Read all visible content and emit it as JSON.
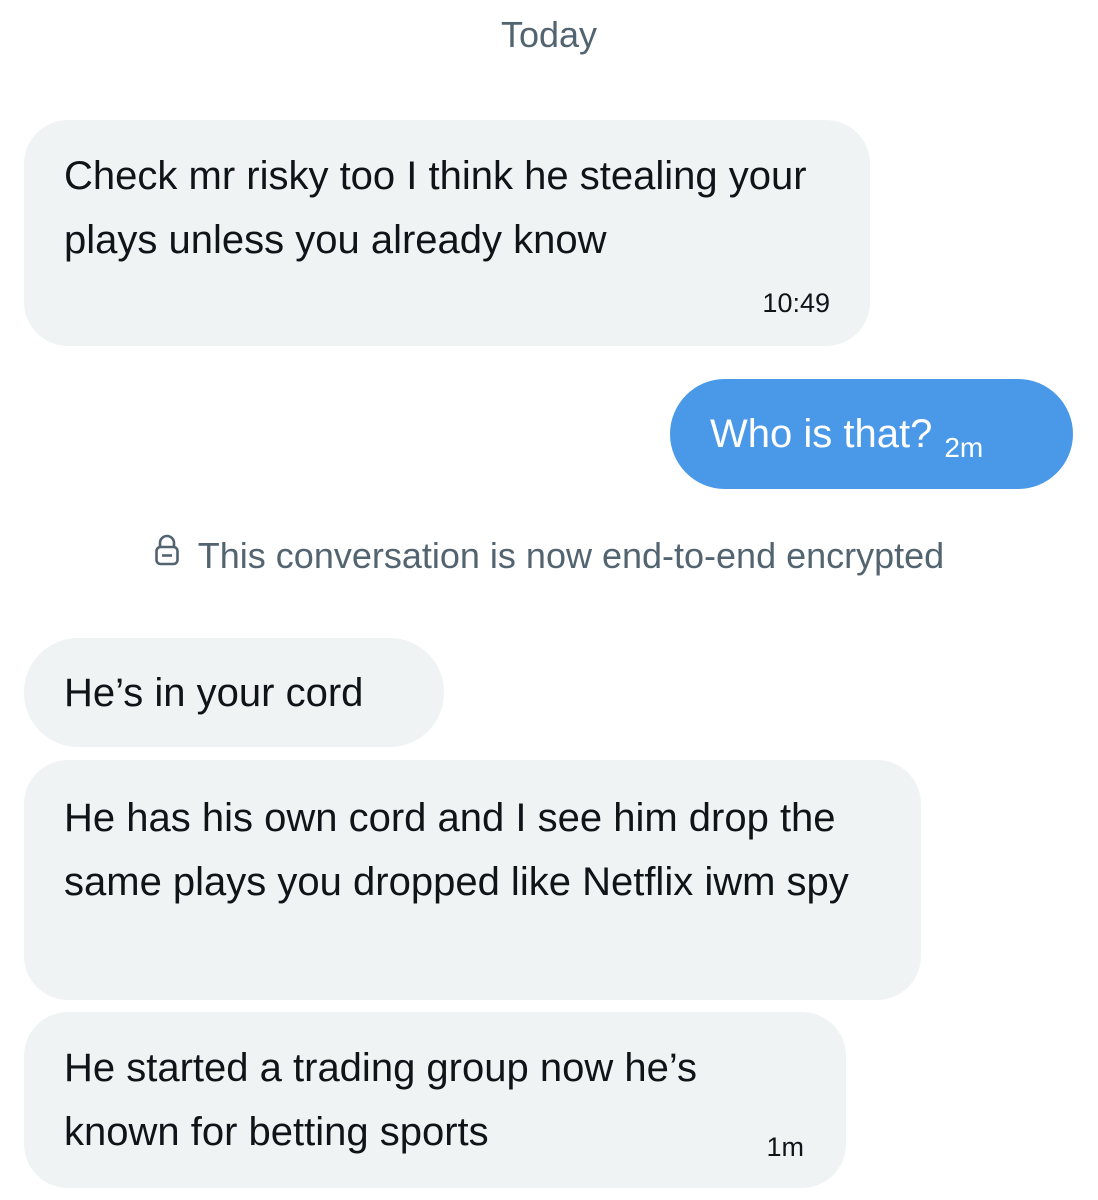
{
  "date_separator": "Today",
  "messages": [
    {
      "direction": "incoming",
      "text": "Check mr risky too I think he stealing your plays unless you already know",
      "time": "10:49"
    },
    {
      "direction": "outgoing",
      "text": "Who is that?",
      "time": "2m"
    },
    {
      "direction": "incoming",
      "text": "He’s in your cord",
      "time": ""
    },
    {
      "direction": "incoming",
      "text": "He has his own cord and I see him drop the same plays you dropped like Netflix iwm spy",
      "time": ""
    },
    {
      "direction": "incoming",
      "text": "He started a trading group now he’s known for betting sports",
      "time": "1m"
    }
  ],
  "encryption_notice": {
    "icon": "lock-icon",
    "text": "This conversation is now end-to-end encrypted"
  },
  "colors": {
    "incoming_bubble": "#eff3f4",
    "outgoing_bubble": "#4a99e9",
    "secondary_text": "#536471",
    "primary_text": "#0f1419"
  }
}
